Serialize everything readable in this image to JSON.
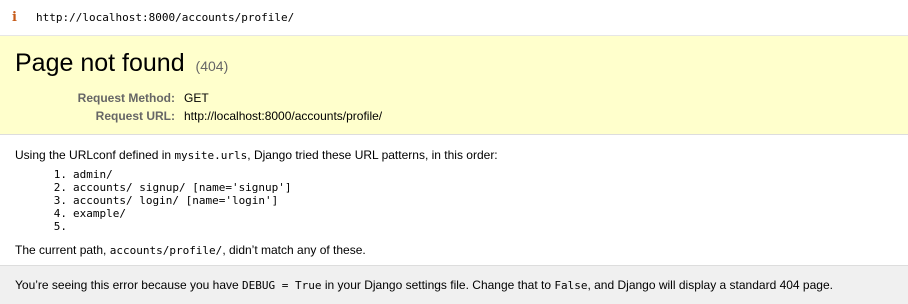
{
  "browser": {
    "url": "http://localhost:8000/accounts/profile/",
    "info_icon": "i"
  },
  "summary": {
    "title": "Page not found",
    "status_code": "(404)",
    "request_method_label": "Request Method:",
    "request_method_value": "GET",
    "request_url_label": "Request URL:",
    "request_url_value": "http://localhost:8000/accounts/profile/"
  },
  "info": {
    "intro_before": "Using the URLconf defined in ",
    "urlconf": "mysite.urls",
    "intro_after": ", Django tried these URL patterns, in this order:",
    "patterns": [
      {
        "num": "1.",
        "text": "admin/"
      },
      {
        "num": "2.",
        "text": "accounts/ signup/ [name='signup']"
      },
      {
        "num": "3.",
        "text": "accounts/ login/ [name='login']"
      },
      {
        "num": "4.",
        "text": "example/"
      },
      {
        "num": "5.",
        "text": ""
      }
    ],
    "result_before": "The current path, ",
    "current_path": "accounts/profile/",
    "result_after": ", didn’t match any of these."
  },
  "explanation": {
    "part1": "You’re seeing this error because you have ",
    "debug_setting": "DEBUG = True",
    "part2": " in your Django settings file. Change that to ",
    "false_value": "False",
    "part3": ", and Django will display a standard 404 page."
  },
  "colors": {
    "summary_bg": "#ffffcc",
    "explanation_bg": "#f0f0f0",
    "label_gray": "#666666",
    "info_icon": "#c65a18"
  }
}
